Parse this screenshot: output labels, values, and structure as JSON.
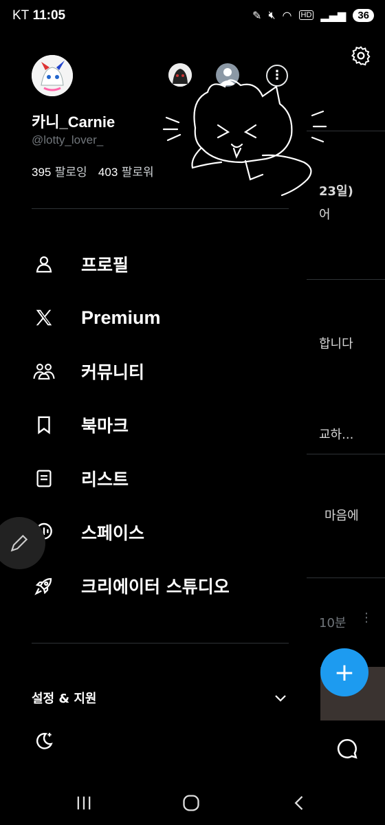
{
  "status_bar": {
    "carrier": "KT",
    "time": "11:05",
    "battery": "36",
    "hd": "HD"
  },
  "profile": {
    "name": "카니_Carnie",
    "handle": "@lotty_lover_",
    "following_count": "395",
    "following_label": "팔로잉",
    "followers_count": "403",
    "followers_label": "팔로워"
  },
  "menu": {
    "items": [
      {
        "label": "프로필",
        "icon": "person-icon"
      },
      {
        "label": "Premium",
        "icon": "x-logo-icon"
      },
      {
        "label": "커뮤니티",
        "icon": "community-icon"
      },
      {
        "label": "북마크",
        "icon": "bookmark-icon"
      },
      {
        "label": "리스트",
        "icon": "list-icon"
      },
      {
        "label": "스페이스",
        "icon": "spaces-icon"
      },
      {
        "label": "크리에이터 스튜디오",
        "icon": "rocket-icon"
      }
    ]
  },
  "settings": {
    "label": "설정 & 지원"
  },
  "background": {
    "snippets": [
      "23일)",
      "어",
      "합니다",
      "교하...",
      "마음에",
      "10분"
    ]
  },
  "colors": {
    "accent": "#1d9bf0",
    "background": "#000000",
    "divider": "#2f3336",
    "secondary_text": "#71767b"
  }
}
